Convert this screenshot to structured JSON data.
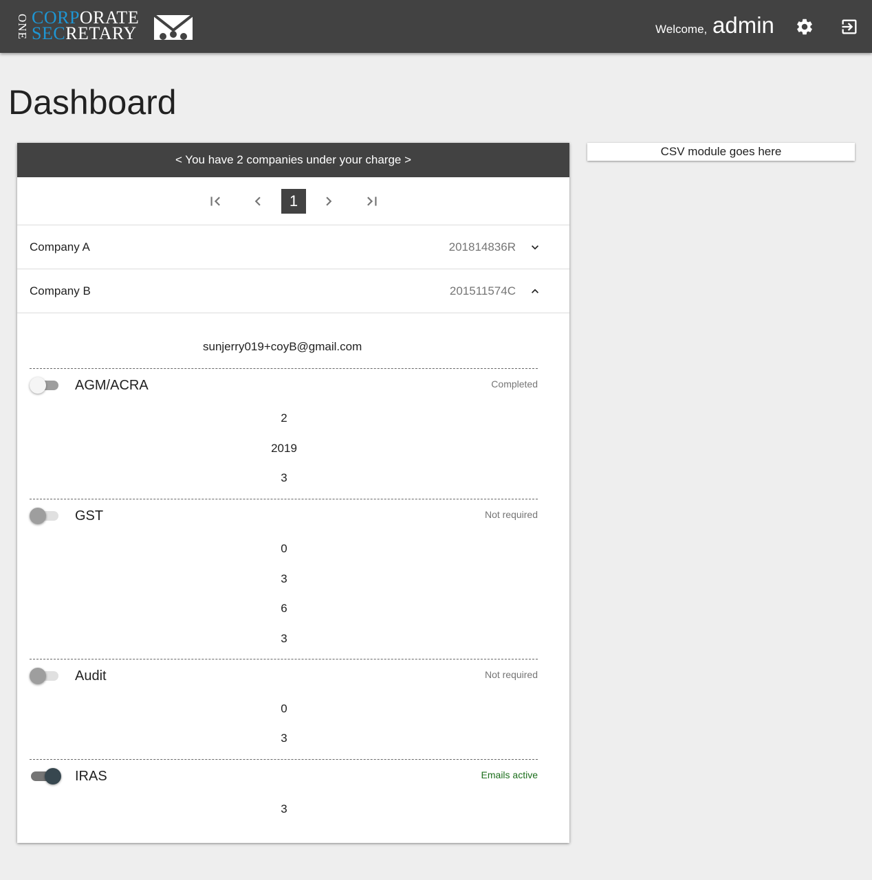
{
  "header": {
    "logo": {
      "one": "ONE",
      "line1_blue": "CORP",
      "line1_white": "ORATE",
      "line2_blue": "SEC",
      "line2_white": "RETARY"
    },
    "welcome": "Welcome,",
    "username": "admin",
    "icons": [
      "gear-icon",
      "logout-icon"
    ]
  },
  "page": {
    "title": "Dashboard"
  },
  "panel": {
    "banner": "< You have 2 companies under your charge >",
    "pager": {
      "current_page": "1"
    },
    "companies": [
      {
        "name": "Company A",
        "id": "201814836R",
        "expanded": false
      },
      {
        "name": "Company B",
        "id": "201511574C",
        "expanded": true
      }
    ],
    "details": {
      "email": "sunjerry019+coyB@gmail.com",
      "sections": [
        {
          "title": "AGM/ACRA",
          "status": "Completed",
          "toggle_on": false,
          "values": [
            "2",
            "2019",
            "3"
          ]
        },
        {
          "title": "GST",
          "status": "Not required",
          "toggle_on": false,
          "values": [
            "0",
            "3",
            "6",
            "3"
          ]
        },
        {
          "title": "Audit",
          "status": "Not required",
          "toggle_on": false,
          "values": [
            "0",
            "3"
          ]
        },
        {
          "title": "IRAS",
          "status": "Emails active",
          "toggle_on": true,
          "values": [
            "3"
          ]
        }
      ]
    }
  },
  "csv": {
    "label": "CSV module goes here"
  },
  "colors": {
    "header_bg": "#424242",
    "logo_blue": "#1e96d4",
    "status_green": "#1b6e1b",
    "toggle_on": "#37474f"
  }
}
